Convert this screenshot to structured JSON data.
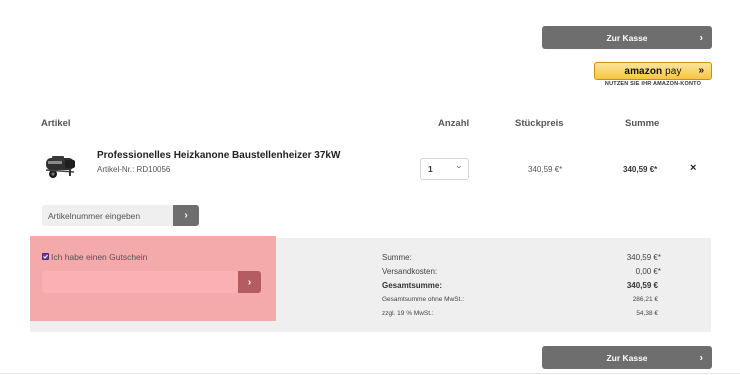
{
  "checkout": {
    "top_label": "Zur Kasse",
    "bottom_label": "Zur Kasse"
  },
  "amazon_pay": {
    "logo_text_amazon": "amazon",
    "logo_text_pay": "pay",
    "arrows": "»",
    "caption": "NUTZEN SIE IHR AMAZON-KONTO"
  },
  "table": {
    "headers": {
      "article": "Artikel",
      "quantity": "Anzahl",
      "unit_price": "Stückpreis",
      "total": "Summe"
    },
    "items": [
      {
        "name": "Professionelles Heizkanone Baustellenheizer 37kW",
        "sku": "Artikel-Nr.: RD10056",
        "quantity": "1",
        "unit_price": "340,59 €*",
        "total": "340,59 €*",
        "remove": "×"
      }
    ]
  },
  "article_input": {
    "placeholder": "Artikelnummer eingeben",
    "submit": "›"
  },
  "voucher": {
    "checkbox_label": "Ich habe einen Gutschein",
    "checked": true,
    "submit": "›",
    "value": ""
  },
  "summary": {
    "rows": [
      {
        "label": "Summe:",
        "value": "340,59 €*"
      },
      {
        "label": "Versandkosten:",
        "value": "0,00 €*"
      },
      {
        "label": "Gesamtsumme:",
        "value": "340,59 €"
      },
      {
        "label": "Gesamtsumme ohne MwSt.:",
        "value": "286,21 €"
      },
      {
        "label": "zzgl. 19 % MwSt.:",
        "value": "54,38 €"
      }
    ]
  },
  "colors": {
    "button": "#6e6e6e",
    "voucher_highlight": "#f4a9ab",
    "summary_bg": "#efefef",
    "checkbox": "#6a3fa0"
  }
}
